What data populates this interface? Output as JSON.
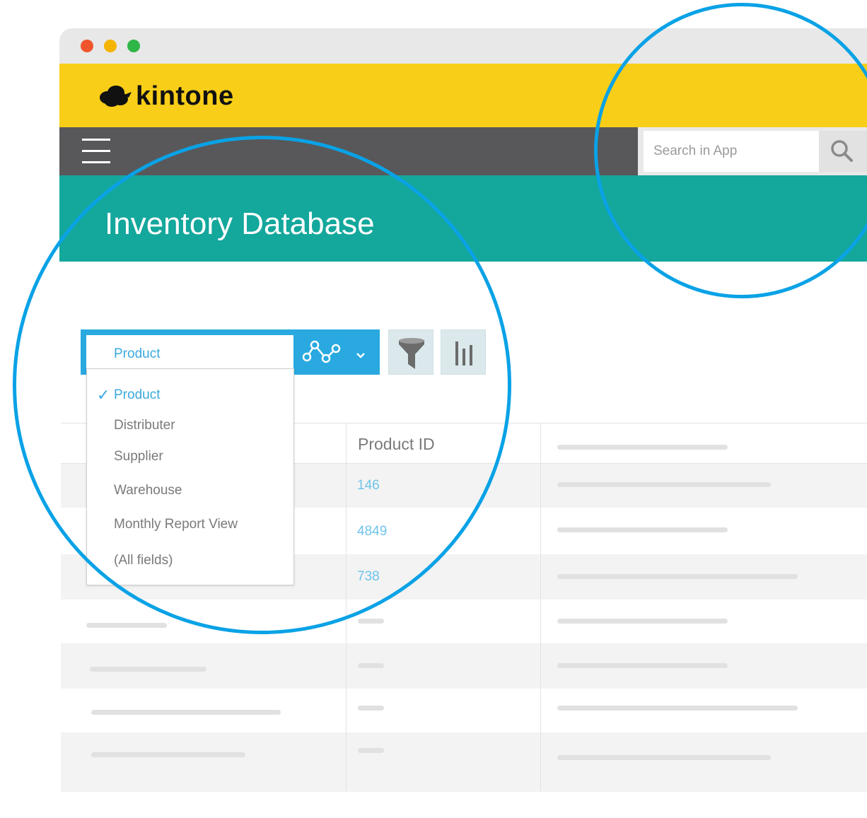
{
  "brand": {
    "name": "kintone"
  },
  "search": {
    "placeholder": "Search in App"
  },
  "app": {
    "title": "Inventory Database"
  },
  "view_selector": {
    "current": "Product",
    "options": [
      {
        "label": "Product",
        "selected": true
      },
      {
        "label": "Distributer",
        "selected": false
      },
      {
        "label": "Supplier",
        "selected": false
      },
      {
        "label": "Warehouse",
        "selected": false
      },
      {
        "label": "Monthly Report View",
        "selected": false
      },
      {
        "label": "(All fields)",
        "selected": false
      }
    ]
  },
  "toolbar": {
    "icons": [
      "graph-icon",
      "chevron-down-icon",
      "filter-icon",
      "bar-chart-icon"
    ]
  },
  "table": {
    "columns": [
      "",
      "Product ID",
      ""
    ],
    "rows": [
      {
        "product_id": "146"
      },
      {
        "product_id": "4849"
      },
      {
        "product_id": "738"
      },
      {
        "product_id": ""
      },
      {
        "product_id": ""
      },
      {
        "product_id": ""
      },
      {
        "product_id": ""
      }
    ]
  },
  "colors": {
    "brand_yellow": "#f8ce18",
    "nav_gray": "#58585a",
    "header_teal": "#14a79c",
    "accent_blue": "#29a9e0",
    "highlight_ring": "#0aa2e6"
  }
}
